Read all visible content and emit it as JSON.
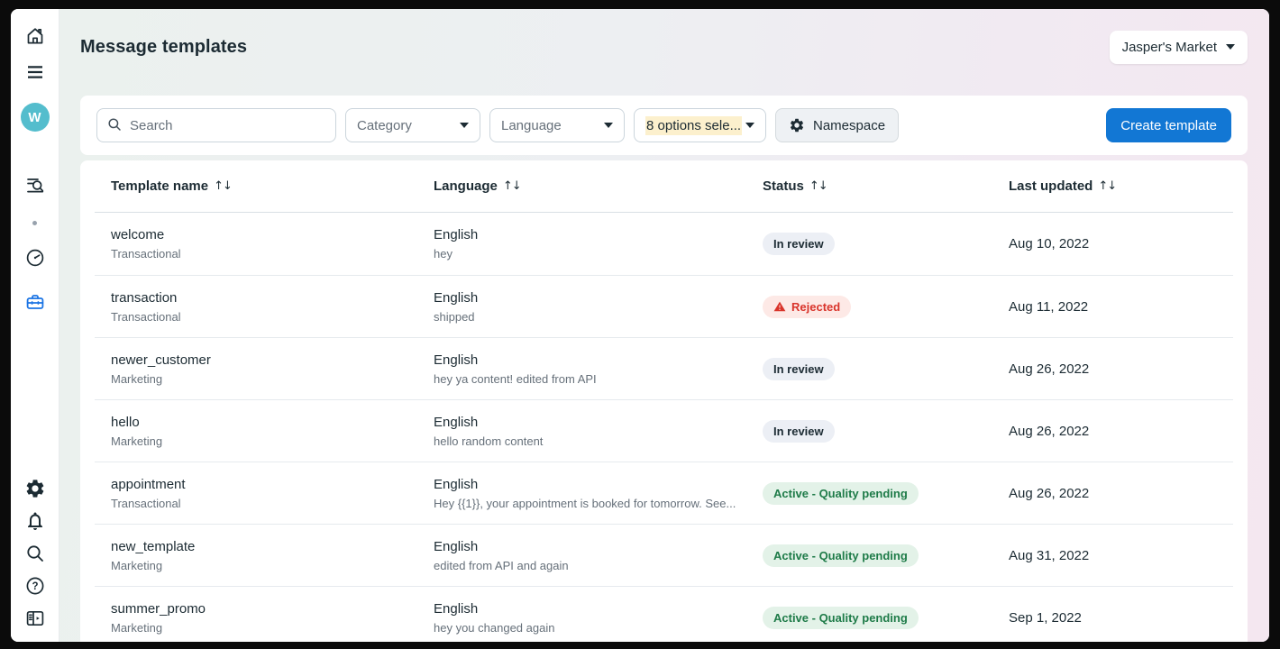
{
  "header": {
    "title": "Message templates",
    "account_switcher": "Jasper's Market"
  },
  "sidebar": {
    "avatar_initial": "W"
  },
  "filters": {
    "search_placeholder": "Search",
    "category_label": "Category",
    "language_label": "Language",
    "options_selected_label": "8 options sele...",
    "namespace_label": "Namespace",
    "create_button": "Create template"
  },
  "table": {
    "columns": [
      "Template name",
      "Language",
      "Status",
      "Last updated"
    ],
    "sort_glyph": "↑↓",
    "rows": [
      {
        "name": "welcome",
        "category": "Transactional",
        "language": "English",
        "content": "hey",
        "status": "In review",
        "status_type": "in-review",
        "updated": "Aug 10, 2022"
      },
      {
        "name": "transaction",
        "category": "Transactional",
        "language": "English",
        "content": "shipped",
        "status": "Rejected",
        "status_type": "rejected",
        "updated": "Aug 11, 2022"
      },
      {
        "name": "newer_customer",
        "category": "Marketing",
        "language": "English",
        "content": "hey ya content! edited from API",
        "status": "In review",
        "status_type": "in-review",
        "updated": "Aug 26, 2022"
      },
      {
        "name": "hello",
        "category": "Marketing",
        "language": "English",
        "content": "hello random content",
        "status": "In review",
        "status_type": "in-review",
        "updated": "Aug 26, 2022"
      },
      {
        "name": "appointment",
        "category": "Transactional",
        "language": "English",
        "content": "Hey {{1}}, your appointment is booked for tomorrow. See...",
        "status": "Active - Quality pending",
        "status_type": "active",
        "updated": "Aug 26, 2022"
      },
      {
        "name": "new_template",
        "category": "Marketing",
        "language": "English",
        "content": "edited from API and again",
        "status": "Active - Quality pending",
        "status_type": "active",
        "updated": "Aug 31, 2022"
      },
      {
        "name": "summer_promo",
        "category": "Marketing",
        "language": "English",
        "content": "hey you changed again",
        "status": "Active - Quality pending",
        "status_type": "active",
        "updated": "Sep 1, 2022"
      }
    ]
  },
  "colors": {
    "accent_blue": "#1277d4",
    "active_icon": "#1b74e4",
    "avatar_bg": "#54bdcd",
    "badge_green_text": "#1e7b48",
    "badge_red_text": "#d9342b",
    "highlight_yellow": "#fcf0cd"
  }
}
